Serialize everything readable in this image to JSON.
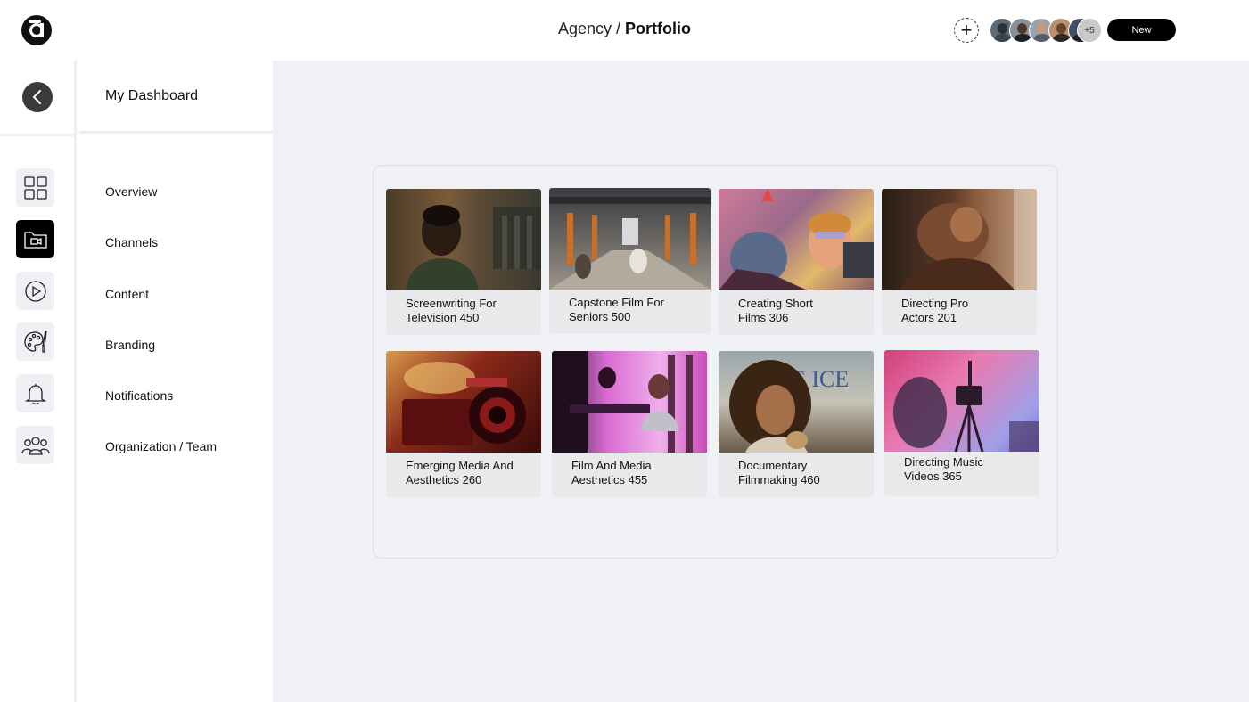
{
  "header": {
    "breadcrumb_parent": "Agency",
    "breadcrumb_sep": " / ",
    "breadcrumb_current": "Portfolio",
    "add_label": "+",
    "avatar_more": "+5",
    "new_label": "New"
  },
  "rail": {
    "icons": [
      "chevron-left-icon",
      "grid-icon",
      "video-folder-icon",
      "play-circle-icon",
      "palette-icon",
      "bell-icon",
      "team-icon"
    ],
    "active": "video-folder-icon"
  },
  "nav": {
    "title": "My Dashboard",
    "items": [
      "Overview",
      "Channels",
      "Content",
      "Branding",
      "Notifications",
      "Organization / Team"
    ]
  },
  "courses": [
    {
      "line1": "Screenwriting For",
      "line2": "Television 450"
    },
    {
      "line1": "Capstone Film For",
      "line2": "Seniors 500"
    },
    {
      "line1": "Creating Short",
      "line2": "Films 306"
    },
    {
      "line1": "Directing Pro",
      "line2": "Actors 201"
    },
    {
      "line1": "Emerging Media And",
      "line2": "Aesthetics 260"
    },
    {
      "line1": "Film And Media",
      "line2": "Aesthetics 455"
    },
    {
      "line1": "Documentary",
      "line2": "Filmmaking 460"
    },
    {
      "line1": "Directing Music",
      "line2": "Videos 365"
    }
  ],
  "colors": {
    "accent": "#000000",
    "main_bg": "#f0f1f5",
    "rail_btn_bg": "#eef0f4",
    "card_bg": "#e9e9ec"
  }
}
